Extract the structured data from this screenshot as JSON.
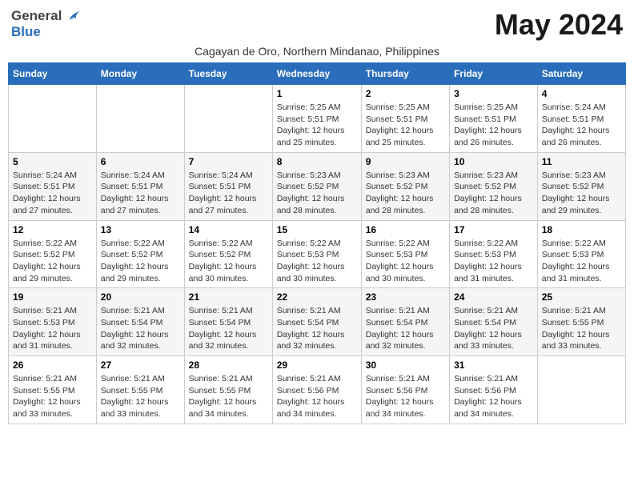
{
  "header": {
    "logo_general": "General",
    "logo_blue": "Blue",
    "month_title": "May 2024",
    "subtitle": "Cagayan de Oro, Northern Mindanao, Philippines"
  },
  "days_of_week": [
    "Sunday",
    "Monday",
    "Tuesday",
    "Wednesday",
    "Thursday",
    "Friday",
    "Saturday"
  ],
  "weeks": [
    [
      {
        "day": "",
        "info": ""
      },
      {
        "day": "",
        "info": ""
      },
      {
        "day": "",
        "info": ""
      },
      {
        "day": "1",
        "info": "Sunrise: 5:25 AM\nSunset: 5:51 PM\nDaylight: 12 hours\nand 25 minutes."
      },
      {
        "day": "2",
        "info": "Sunrise: 5:25 AM\nSunset: 5:51 PM\nDaylight: 12 hours\nand 25 minutes."
      },
      {
        "day": "3",
        "info": "Sunrise: 5:25 AM\nSunset: 5:51 PM\nDaylight: 12 hours\nand 26 minutes."
      },
      {
        "day": "4",
        "info": "Sunrise: 5:24 AM\nSunset: 5:51 PM\nDaylight: 12 hours\nand 26 minutes."
      }
    ],
    [
      {
        "day": "5",
        "info": "Sunrise: 5:24 AM\nSunset: 5:51 PM\nDaylight: 12 hours\nand 27 minutes."
      },
      {
        "day": "6",
        "info": "Sunrise: 5:24 AM\nSunset: 5:51 PM\nDaylight: 12 hours\nand 27 minutes."
      },
      {
        "day": "7",
        "info": "Sunrise: 5:24 AM\nSunset: 5:51 PM\nDaylight: 12 hours\nand 27 minutes."
      },
      {
        "day": "8",
        "info": "Sunrise: 5:23 AM\nSunset: 5:52 PM\nDaylight: 12 hours\nand 28 minutes."
      },
      {
        "day": "9",
        "info": "Sunrise: 5:23 AM\nSunset: 5:52 PM\nDaylight: 12 hours\nand 28 minutes."
      },
      {
        "day": "10",
        "info": "Sunrise: 5:23 AM\nSunset: 5:52 PM\nDaylight: 12 hours\nand 28 minutes."
      },
      {
        "day": "11",
        "info": "Sunrise: 5:23 AM\nSunset: 5:52 PM\nDaylight: 12 hours\nand 29 minutes."
      }
    ],
    [
      {
        "day": "12",
        "info": "Sunrise: 5:22 AM\nSunset: 5:52 PM\nDaylight: 12 hours\nand 29 minutes."
      },
      {
        "day": "13",
        "info": "Sunrise: 5:22 AM\nSunset: 5:52 PM\nDaylight: 12 hours\nand 29 minutes."
      },
      {
        "day": "14",
        "info": "Sunrise: 5:22 AM\nSunset: 5:52 PM\nDaylight: 12 hours\nand 30 minutes."
      },
      {
        "day": "15",
        "info": "Sunrise: 5:22 AM\nSunset: 5:53 PM\nDaylight: 12 hours\nand 30 minutes."
      },
      {
        "day": "16",
        "info": "Sunrise: 5:22 AM\nSunset: 5:53 PM\nDaylight: 12 hours\nand 30 minutes."
      },
      {
        "day": "17",
        "info": "Sunrise: 5:22 AM\nSunset: 5:53 PM\nDaylight: 12 hours\nand 31 minutes."
      },
      {
        "day": "18",
        "info": "Sunrise: 5:22 AM\nSunset: 5:53 PM\nDaylight: 12 hours\nand 31 minutes."
      }
    ],
    [
      {
        "day": "19",
        "info": "Sunrise: 5:21 AM\nSunset: 5:53 PM\nDaylight: 12 hours\nand 31 minutes."
      },
      {
        "day": "20",
        "info": "Sunrise: 5:21 AM\nSunset: 5:54 PM\nDaylight: 12 hours\nand 32 minutes."
      },
      {
        "day": "21",
        "info": "Sunrise: 5:21 AM\nSunset: 5:54 PM\nDaylight: 12 hours\nand 32 minutes."
      },
      {
        "day": "22",
        "info": "Sunrise: 5:21 AM\nSunset: 5:54 PM\nDaylight: 12 hours\nand 32 minutes."
      },
      {
        "day": "23",
        "info": "Sunrise: 5:21 AM\nSunset: 5:54 PM\nDaylight: 12 hours\nand 32 minutes."
      },
      {
        "day": "24",
        "info": "Sunrise: 5:21 AM\nSunset: 5:54 PM\nDaylight: 12 hours\nand 33 minutes."
      },
      {
        "day": "25",
        "info": "Sunrise: 5:21 AM\nSunset: 5:55 PM\nDaylight: 12 hours\nand 33 minutes."
      }
    ],
    [
      {
        "day": "26",
        "info": "Sunrise: 5:21 AM\nSunset: 5:55 PM\nDaylight: 12 hours\nand 33 minutes."
      },
      {
        "day": "27",
        "info": "Sunrise: 5:21 AM\nSunset: 5:55 PM\nDaylight: 12 hours\nand 33 minutes."
      },
      {
        "day": "28",
        "info": "Sunrise: 5:21 AM\nSunset: 5:55 PM\nDaylight: 12 hours\nand 34 minutes."
      },
      {
        "day": "29",
        "info": "Sunrise: 5:21 AM\nSunset: 5:56 PM\nDaylight: 12 hours\nand 34 minutes."
      },
      {
        "day": "30",
        "info": "Sunrise: 5:21 AM\nSunset: 5:56 PM\nDaylight: 12 hours\nand 34 minutes."
      },
      {
        "day": "31",
        "info": "Sunrise: 5:21 AM\nSunset: 5:56 PM\nDaylight: 12 hours\nand 34 minutes."
      },
      {
        "day": "",
        "info": ""
      }
    ]
  ]
}
